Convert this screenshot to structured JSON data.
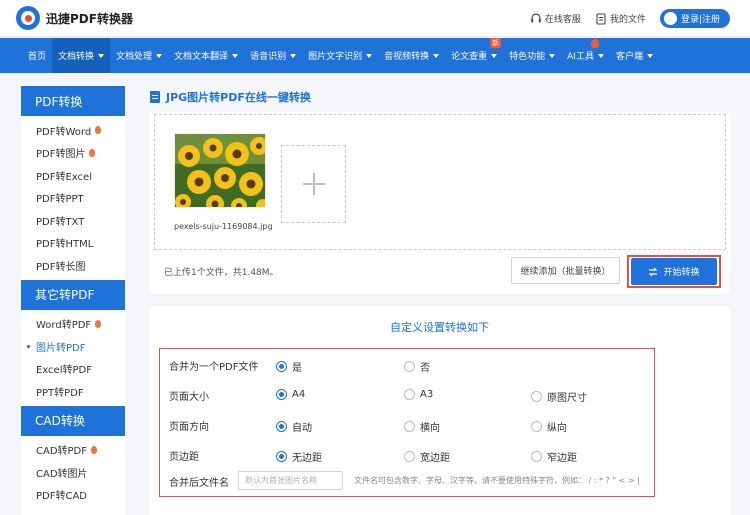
{
  "header": {
    "logo_text": "迅捷PDF转换器",
    "service_label": "在线客服",
    "files_label": "我的文件",
    "login_label": "登录|注册"
  },
  "nav": {
    "items": [
      {
        "label": "首页",
        "caret": false
      },
      {
        "label": "文档转换",
        "caret": true,
        "active": true
      },
      {
        "label": "文档处理",
        "caret": true
      },
      {
        "label": "文档文本翻译",
        "caret": true
      },
      {
        "label": "语音识别",
        "caret": true
      },
      {
        "label": "图片文字识别",
        "caret": true
      },
      {
        "label": "音视频转换",
        "caret": true
      },
      {
        "label": "论文查重",
        "caret": true,
        "badge": "新"
      },
      {
        "label": "特色功能",
        "caret": true
      },
      {
        "label": "AI工具",
        "caret": true,
        "hot": true
      },
      {
        "label": "客户端",
        "caret": true
      }
    ]
  },
  "sidebar": {
    "sections": [
      {
        "title": "PDF转换",
        "items": [
          {
            "label": "PDF转Word",
            "hot": true
          },
          {
            "label": "PDF转图片",
            "hot": true
          },
          {
            "label": "PDF转Excel"
          },
          {
            "label": "PDF转PPT"
          },
          {
            "label": "PDF转TXT"
          },
          {
            "label": "PDF转HTML"
          },
          {
            "label": "PDF转长图"
          }
        ]
      },
      {
        "title": "其它转PDF",
        "items": [
          {
            "label": "Word转PDF",
            "hot": true
          },
          {
            "label": "图片转PDF",
            "active": true
          },
          {
            "label": "Excel转PDF"
          },
          {
            "label": "PPT转PDF"
          }
        ]
      },
      {
        "title": "CAD转换",
        "items": [
          {
            "label": "CAD转PDF",
            "hot": true
          },
          {
            "label": "CAD转图片"
          },
          {
            "label": "PDF转CAD"
          }
        ]
      }
    ]
  },
  "main": {
    "title": "JPG图片转PDF在线一键转换",
    "file_name": "pexels-suju-1169084.jpg",
    "upload_status": "已上传1个文件，共1.48M。",
    "continue_button": "继续添加（批量转换）",
    "start_button": "开始转换"
  },
  "settings": {
    "title": "自定义设置转换如下",
    "rows": [
      {
        "label": "合并为一个PDF文件",
        "options": [
          {
            "label": "是",
            "selected": true
          },
          {
            "label": "否",
            "selected": false
          }
        ]
      },
      {
        "label": "页面大小",
        "options": [
          {
            "label": "A4",
            "selected": true
          },
          {
            "label": "A3",
            "selected": false
          },
          {
            "label": "原图尺寸",
            "selected": false
          }
        ]
      },
      {
        "label": "页面方向",
        "options": [
          {
            "label": "自动",
            "selected": true
          },
          {
            "label": "横向",
            "selected": false
          },
          {
            "label": "纵向",
            "selected": false
          }
        ]
      },
      {
        "label": "页边距",
        "options": [
          {
            "label": "无边距",
            "selected": true
          },
          {
            "label": "宽边距",
            "selected": false
          },
          {
            "label": "窄边距",
            "selected": false
          }
        ]
      }
    ],
    "filename_label": "合并后文件名",
    "filename_placeholder": "默认为首张图片名称",
    "filename_value": "",
    "filename_hint": "文件名可包含数字、字母、汉字等。请不要使用特殊字符，例如： / : * ? \" < > |"
  },
  "colors": {
    "primary": "#1e72d8",
    "highlight": "#e05247",
    "hot": "#f0743b"
  }
}
